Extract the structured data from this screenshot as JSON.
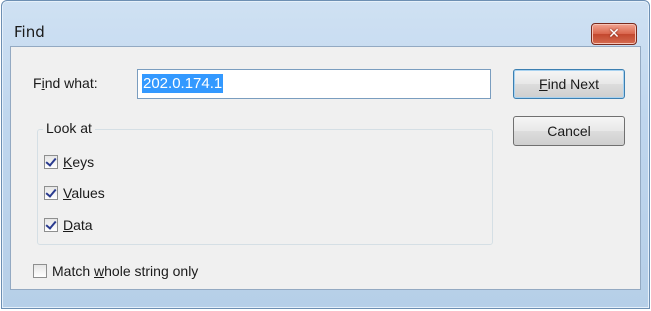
{
  "window": {
    "title": "Find",
    "close_glyph": "✕"
  },
  "find": {
    "label_prefix": "F",
    "label_accel": "i",
    "label_suffix": "nd what:",
    "value": "202.0.174.1"
  },
  "buttons": {
    "find_next_accel": "F",
    "find_next_rest": "ind Next",
    "cancel": "Cancel"
  },
  "look_at": {
    "legend": "Look at",
    "options": [
      {
        "accel": "K",
        "rest": "eys",
        "checked": true
      },
      {
        "accel": "V",
        "rest": "alues",
        "checked": true
      },
      {
        "accel": "D",
        "rest": "ata",
        "checked": true
      }
    ]
  },
  "match_whole": {
    "prefix": "Match ",
    "accel": "w",
    "suffix": "hole string only",
    "checked": false
  },
  "colors": {
    "title_gradient_top": "#cfe1f3",
    "close_red": "#c3482f",
    "selection": "#3399ff",
    "dialog_bg": "#f0f0f0"
  }
}
